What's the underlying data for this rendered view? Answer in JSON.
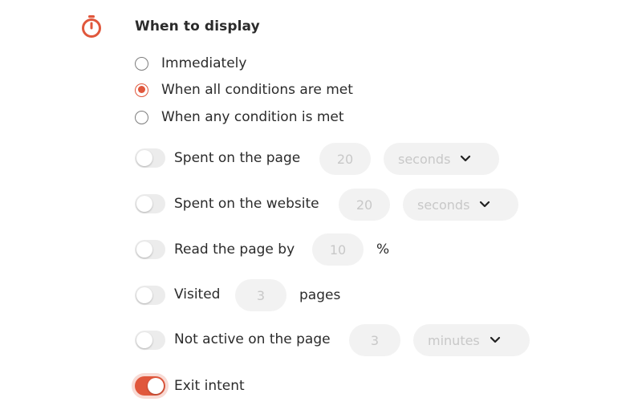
{
  "section": {
    "title": "When to display",
    "icon": "timer-icon",
    "accent": "#e0573c"
  },
  "display_options": [
    {
      "label": "Immediately",
      "checked": false
    },
    {
      "label": "When all conditions are met",
      "checked": true
    },
    {
      "label": "When any condition is met",
      "checked": false
    }
  ],
  "conditions": [
    {
      "label": "Spent on the page",
      "enabled": false,
      "value": "20",
      "unit": "seconds"
    },
    {
      "label": "Spent on the website",
      "enabled": false,
      "value": "20",
      "unit": "seconds"
    },
    {
      "label": "Read the page by",
      "enabled": false,
      "value": "10",
      "suffix": "%"
    },
    {
      "label": "Visited",
      "enabled": false,
      "value": "3",
      "suffix": "pages"
    },
    {
      "label": "Not active on the page",
      "enabled": false,
      "value": "3",
      "unit": "minutes"
    },
    {
      "label": "Exit intent",
      "enabled": true
    }
  ]
}
